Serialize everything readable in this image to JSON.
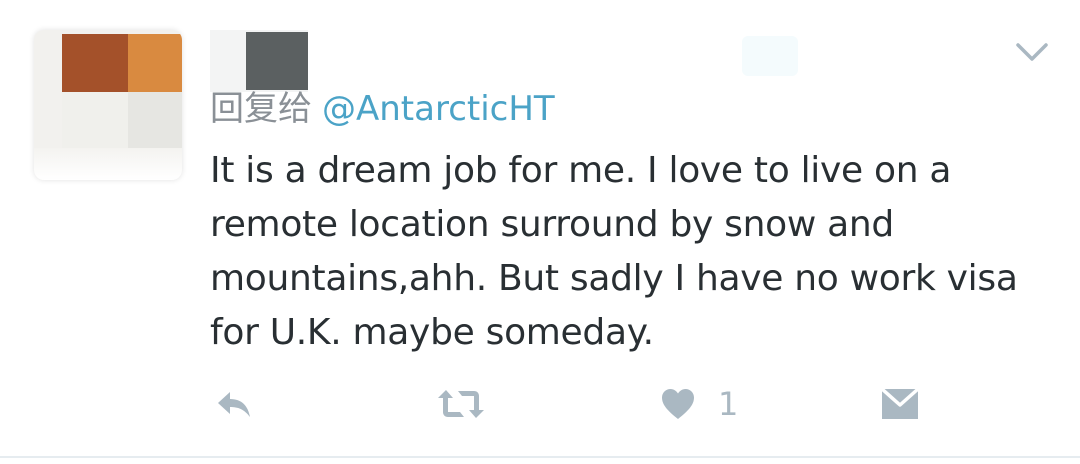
{
  "tweet": {
    "reply_prefix": "回复给",
    "reply_handle": "@AntarcticHT",
    "text_lines": [
      "It is a dream job for me. I love to live on a",
      "remote location surround by snow and",
      "mountains,ahh. But sadly I have no work visa",
      "for U.K. maybe someday."
    ],
    "like_count": "1"
  },
  "icons": {
    "caret": "chevron-down-icon",
    "reply": "reply-icon",
    "retweet": "retweet-icon",
    "like": "heart-icon",
    "dm": "envelope-icon"
  },
  "colors": {
    "text": "#292f33",
    "handle": "#4ba3c7",
    "muted": "#8a9096",
    "icon": "#aab8c2"
  }
}
